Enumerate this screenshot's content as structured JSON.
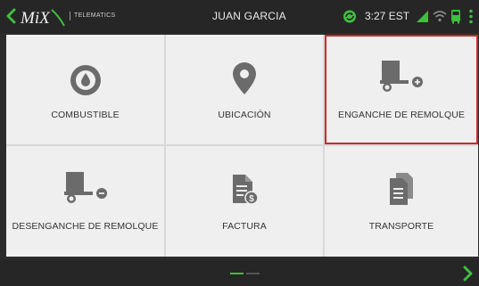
{
  "app": {
    "logo_text": "MiX",
    "logo_sub": "TELEMATICS",
    "user_name": "JUAN GARCIA",
    "time": "3:27 EST"
  },
  "colors": {
    "accent_green": "#3fbf3f",
    "selection_red": "#d0262d",
    "tile_bg": "#efefef",
    "icon_gray": "#6b6b6b"
  },
  "status_icons": [
    "sync-icon",
    "signal-icon",
    "wifi-icon",
    "bus-icon",
    "more-vert-icon"
  ],
  "tiles": [
    {
      "label": "COMBUSTIBLE",
      "icon": "fuel-drop-icon"
    },
    {
      "label": "UBICACIÓN",
      "icon": "location-pin-icon"
    },
    {
      "label": "ENGANCHE DE REMOLQUE",
      "icon": "trailer-hitch-icon",
      "selected": true
    },
    {
      "label": "DESENGANCHE DE REMOLQUE",
      "icon": "trailer-unhitch-icon"
    },
    {
      "label": "FACTURA",
      "icon": "invoice-icon"
    },
    {
      "label": "TRANSPORTE",
      "icon": "documents-icon"
    }
  ],
  "pager": {
    "current": 1,
    "total": 2
  }
}
